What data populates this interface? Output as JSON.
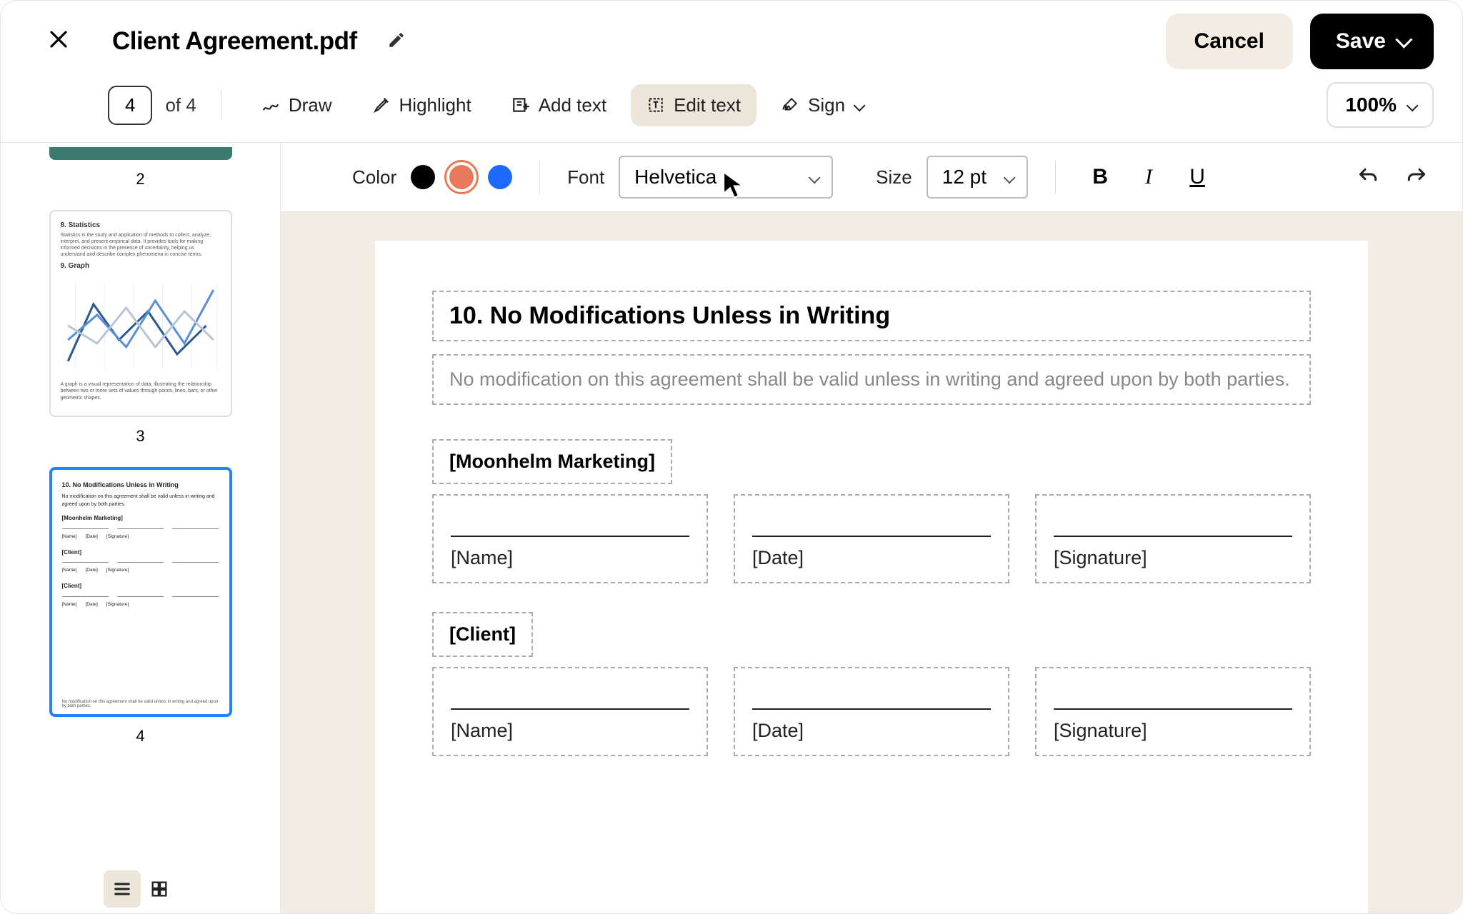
{
  "header": {
    "title": "Client Agreement.pdf",
    "cancel": "Cancel",
    "save": "Save"
  },
  "toolbar": {
    "page_current": "4",
    "page_of": "of 4",
    "draw": "Draw",
    "highlight": "Highlight",
    "add_text": "Add text",
    "edit_text": "Edit text",
    "sign": "Sign",
    "zoom": "100%"
  },
  "format": {
    "color_label": "Color",
    "colors": {
      "black": "#000000",
      "orange": "#e8795a",
      "blue": "#1f6bff"
    },
    "selected_color": "orange",
    "font_label": "Font",
    "font_value": "Helvetica",
    "size_label": "Size",
    "size_value": "12 pt"
  },
  "sidebar": {
    "thumb2_num": "2",
    "thumb3_num": "3",
    "thumb4_num": "4",
    "thumb3": {
      "h1": "8. Statistics",
      "p1": "Statistics is the study and application of methods to collect, analyze, interpret, and present empirical data. It provides tools for making informed decisions in the presence of uncertainty, helping us understand and describe complex phenomena in concise terms.",
      "h2": "9. Graph",
      "p2": "A graph is a visual representation of data, illustrating the relationship between two or more sets of values through points, lines, bars, or other geometric shapes."
    },
    "thumb4": {
      "h": "10. No Modifications Unless in Writing",
      "p": "No modification on this agreement shall be valid unless in writing and agreed upon by both parties.",
      "party1": "[Moonhelm Marketing]",
      "party2": "[Client]",
      "name": "[Name]",
      "date": "[Date]",
      "sig": "[Signature]",
      "foot": "No modification on this agreement shall be valid unless in writing and agreed upon by both parties."
    }
  },
  "document": {
    "heading": "10. No Modifications Unless in Writing",
    "body": "No modification on this agreement shall be valid unless in writing and agreed upon by both parties.",
    "party1": "[Moonhelm Marketing]",
    "party2": "[Client]",
    "field_name": "[Name]",
    "field_date": "[Date]",
    "field_signature": "[Signature]"
  }
}
